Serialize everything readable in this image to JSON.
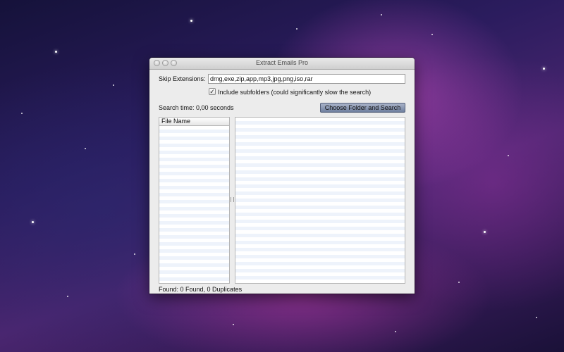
{
  "window": {
    "title": "Extract Emails Pro"
  },
  "form": {
    "skip_label": "Skip Extensions:",
    "skip_value": "dmg,exe,zip,app,mp3,jpg,png,iso,rar",
    "subfolders_checked": true,
    "subfolders_label": "Include subfolders (could significantly slow the search)",
    "search_time": "Search time: 0,00 seconds",
    "search_button": "Choose Folder and Search"
  },
  "table": {
    "column_file_name": "File Name"
  },
  "status": {
    "found": "Found:   0 Found, 0 Duplicates"
  },
  "colors": {
    "accent_button": "#7f8eac",
    "row_stripe": "#eef3fb"
  },
  "icons": {
    "traffic_lights": [
      "close-icon",
      "minimize-icon",
      "zoom-icon"
    ],
    "checkbox_mark": "✓"
  }
}
